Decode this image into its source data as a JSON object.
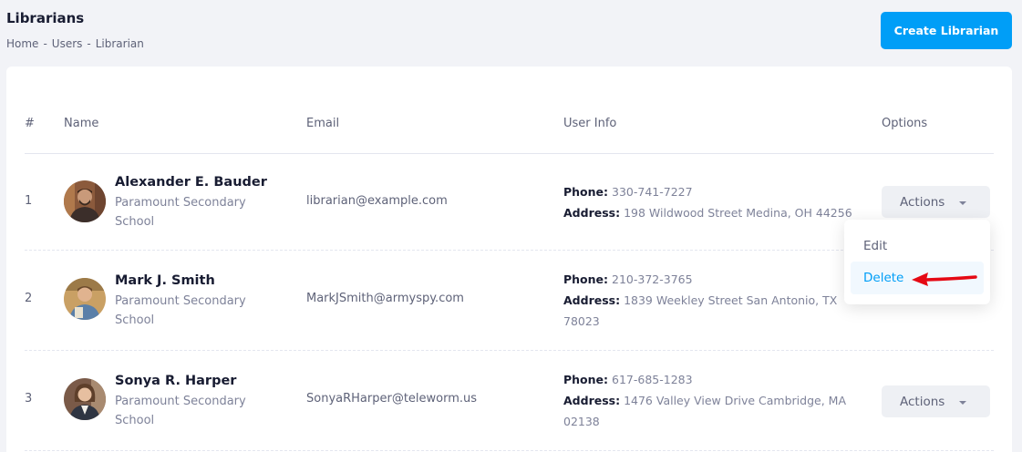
{
  "header": {
    "title": "Librarians",
    "breadcrumb": [
      "Home",
      "-",
      "Users",
      "-",
      "Librarian"
    ],
    "create_label": "Create Librarian"
  },
  "table": {
    "columns": [
      "#",
      "Name",
      "Email",
      "User Info",
      "Options"
    ],
    "phone_label": "Phone:",
    "address_label": "Address:",
    "actions_label": "Actions",
    "rows": [
      {
        "num": "1",
        "name": "Alexander E. Bauder",
        "school": "Paramount Secondary School",
        "email": "librarian@example.com",
        "phone": "330-741-7227",
        "address": "198 Wildwood Street Medina, OH 44256"
      },
      {
        "num": "2",
        "name": "Mark J. Smith",
        "school": "Paramount Secondary School",
        "email": "MarkJSmith@armyspy.com",
        "phone": "210-372-3765",
        "address": "1839 Weekley Street San Antonio, TX 78023"
      },
      {
        "num": "3",
        "name": "Sonya R. Harper",
        "school": "Paramount Secondary School",
        "email": "SonyaRHarper@teleworm.us",
        "phone": "617-685-1283",
        "address": "1476 Valley View Drive Cambridge, MA 02138"
      }
    ]
  },
  "dropdown": {
    "items": [
      "Edit",
      "Delete"
    ]
  },
  "colors": {
    "accent": "#009ef7",
    "annotation_arrow": "#e50914"
  }
}
